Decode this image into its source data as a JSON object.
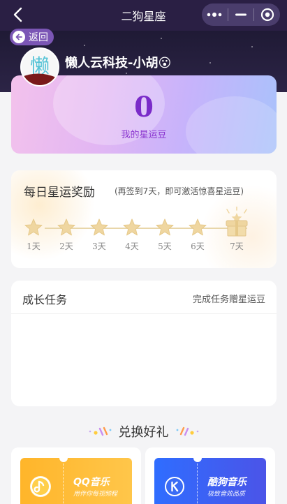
{
  "nav": {
    "title": "二狗星座"
  },
  "header": {
    "back_label": "返回",
    "user_name": "懒人云科技-小胡😮",
    "avatar_text": "懒"
  },
  "beans": {
    "value": "0",
    "label": "我的星运豆"
  },
  "daily": {
    "title": "每日星运奖励",
    "subtitle": "(再签到7天，即可激活惊喜星运豆)",
    "days": [
      "1天",
      "2天",
      "3天",
      "4天",
      "5天",
      "6天",
      "7天"
    ]
  },
  "growth": {
    "title": "成长任务",
    "link": "完成任务赠星运豆"
  },
  "exchange": {
    "title": "兑换好礼",
    "items": [
      {
        "brand": "QQ音乐",
        "slogan": "用伴你每视频程",
        "color": "#ffb52a"
      },
      {
        "brand": "酷狗音乐",
        "slogan": "极致音效品质",
        "color": "#2f6dff"
      }
    ]
  },
  "colors": {
    "nav_bg": "#2a1f44",
    "accent_purple": "#7a2bc9",
    "star_gold": "#efd6a0"
  }
}
